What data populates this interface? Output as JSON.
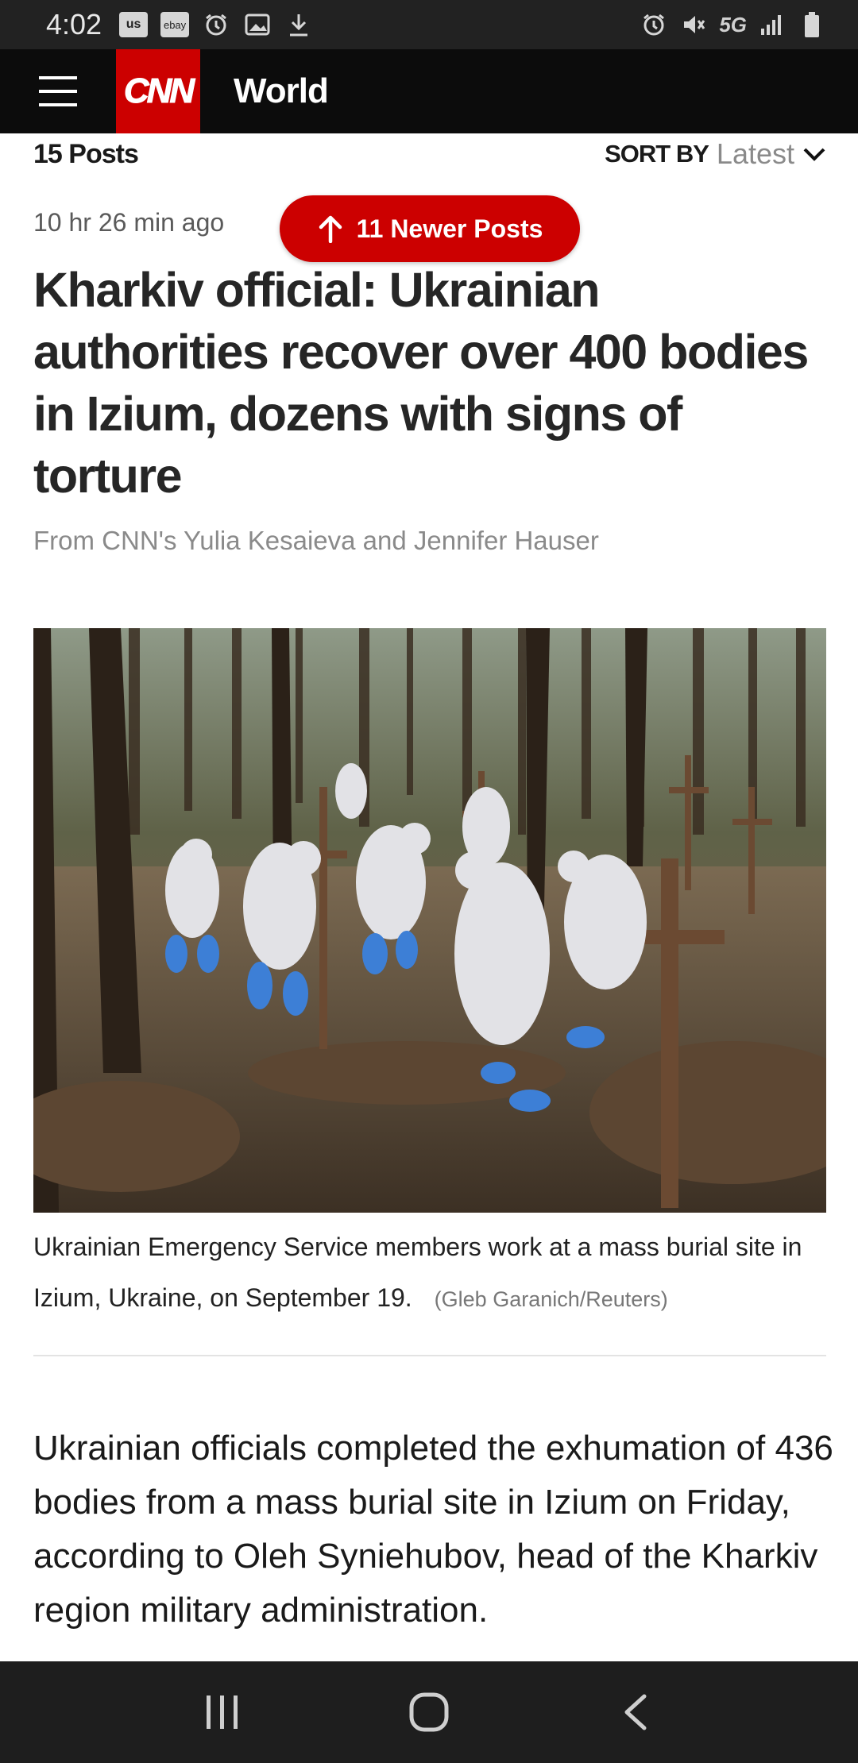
{
  "status_bar": {
    "time": "4:02",
    "left_icons": [
      "us-app-icon",
      "ebay-app-icon",
      "alarm-icon",
      "image-icon",
      "download-icon"
    ],
    "left_badges": {
      "us": "us",
      "ebay": "ebay"
    },
    "network": "5G",
    "right_icons": [
      "alarm-icon",
      "mute-icon",
      "signal-icon",
      "battery-icon"
    ]
  },
  "header": {
    "logo": "CNN",
    "section": "World"
  },
  "posts_bar": {
    "count": "15 Posts",
    "sort_label": "SORT BY",
    "sort_value": "Latest"
  },
  "post": {
    "timestamp": "10 hr 26 min ago",
    "newer_button": "11 Newer Posts",
    "headline": "Kharkiv official: Ukrainian authorities recover over 400 bodies in Izium, dozens with signs of torture",
    "byline": "From CNN's Yulia Kesaieva and Jennifer Hauser",
    "caption": "Ukrainian Emergency Service members work at a mass burial site in Izium, Ukraine, on September 19.",
    "credit": "(Gleb Garanich/Reuters)",
    "body": "Ukrainian officials completed the exhumation of 436 bodies from a mass burial site in Izium on Friday, according to Oleh Syniehubov, head of the Kharkiv region military administration."
  },
  "colors": {
    "brand_red": "#cc0000",
    "header_bg": "#0c0c0c",
    "status_bg": "#222222",
    "nav_bg": "#1e1e1e"
  },
  "nav_bar": [
    "recent-apps-icon",
    "home-icon",
    "back-icon"
  ]
}
